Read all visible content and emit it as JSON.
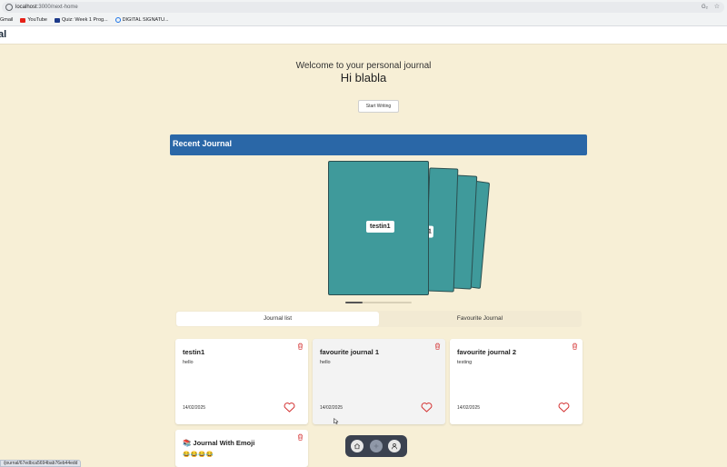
{
  "browser": {
    "url_host": "localhost",
    "url_path": ":3000/next-home",
    "right_icon": "G₂",
    "bookmarks": [
      {
        "label": "Gmail",
        "icon": "gmail-icon"
      },
      {
        "label": "YouTube",
        "icon": "youtube-icon"
      },
      {
        "label": "Quiz: Week 1 Prog...",
        "icon": "quiz-icon"
      },
      {
        "label": "DIGITAL SIGNATU...",
        "icon": "signature-icon"
      }
    ]
  },
  "header": {
    "logo": "al"
  },
  "welcome": {
    "subtitle": "Welcome to your personal journal",
    "greeting": "Hi blabla",
    "start_button": "Start Writing"
  },
  "recent": {
    "title": "Recent Journal",
    "books": [
      {
        "label": "testin1"
      },
      {
        "label": "1"
      }
    ]
  },
  "tabs": [
    {
      "label": "Journal list",
      "active": true
    },
    {
      "label": "Favourite Journal",
      "active": false
    }
  ],
  "cards": [
    {
      "title": "testin1",
      "body": "hello",
      "date": "14/02/2025"
    },
    {
      "title": "favourite journal 1",
      "body": "hello",
      "date": "14/02/2025"
    },
    {
      "title": "favourite journal 2",
      "body": "testing",
      "date": "14/02/2025"
    },
    {
      "title": "📚 Journal With Emoji",
      "body": "😂😂😂😂",
      "date": ""
    }
  ],
  "colors": {
    "background": "#f7efd6",
    "accent": "#2a67a7",
    "book": "#3f9a9b",
    "heart": "#d32f2f"
  },
  "status_link": "/journal/67edbca5694bab76eb44edd"
}
